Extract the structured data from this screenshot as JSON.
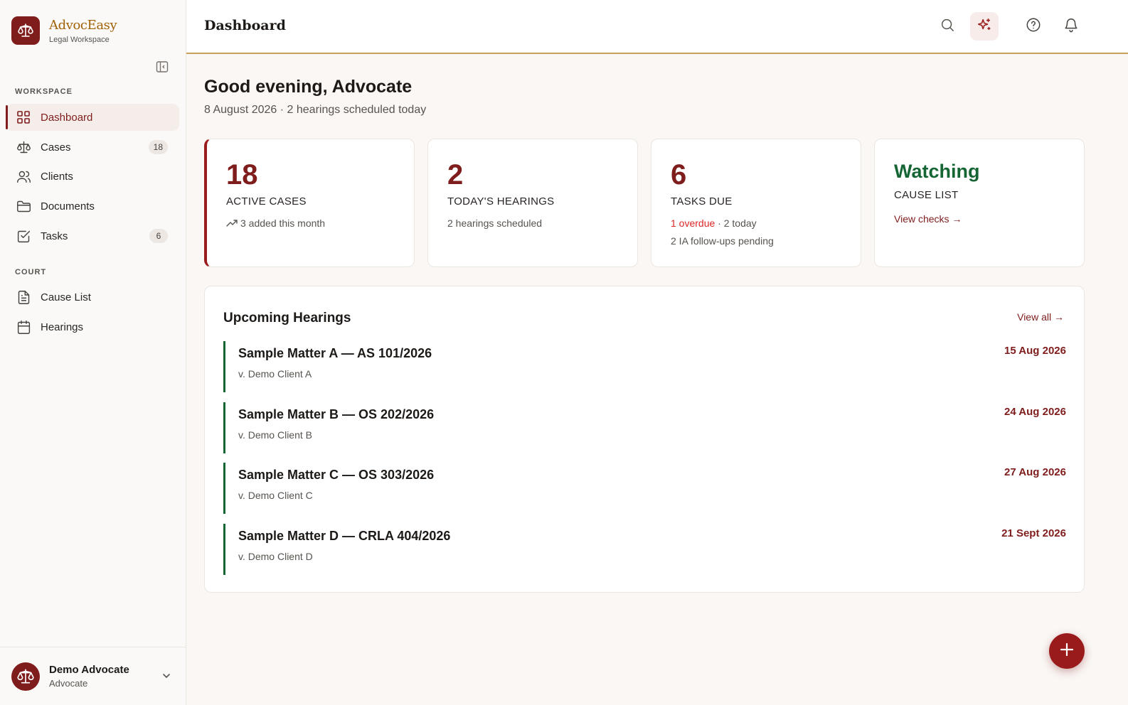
{
  "brand": {
    "name": "AdvocEasy",
    "subtitle": "Legal Workspace",
    "logo_icon": "scales-icon",
    "accent": "#7f1d1d"
  },
  "sidebar": {
    "sections": [
      {
        "label": "WORKSPACE",
        "items": [
          {
            "label": "Dashboard",
            "icon": "grid-icon",
            "active": true
          },
          {
            "label": "Cases",
            "icon": "scales-icon",
            "badge": "18"
          },
          {
            "label": "Clients",
            "icon": "users-icon"
          },
          {
            "label": "Documents",
            "icon": "folder-icon"
          },
          {
            "label": "Tasks",
            "icon": "checkbox-icon",
            "badge": "6"
          }
        ]
      },
      {
        "label": "COURT",
        "items": [
          {
            "label": "Cause List",
            "icon": "document-icon"
          },
          {
            "label": "Hearings",
            "icon": "calendar-icon"
          }
        ]
      }
    ],
    "user": {
      "name": "Demo Advocate",
      "role": "Advocate"
    }
  },
  "header": {
    "title": "Dashboard"
  },
  "greeting": {
    "title": "Good evening, Advocate",
    "subtitle": "8 August 2026 · 2 hearings scheduled today"
  },
  "cards": {
    "active_cases": {
      "value": "18",
      "label": "ACTIVE CASES",
      "sub": "3 added this month"
    },
    "hearings": {
      "value": "2",
      "label": "TODAY'S HEARINGS",
      "sub": "2 hearings scheduled"
    },
    "tasks": {
      "value": "6",
      "label": "TASKS DUE",
      "overdue": "1 overdue",
      "today": " · 2 today",
      "sub2": "2 IA follow-ups pending"
    },
    "cause_list": {
      "status": "Watching",
      "label": "CAUSE LIST",
      "link": "View checks →"
    }
  },
  "upcoming": {
    "title": "Upcoming Hearings",
    "view_all": "View all →",
    "items": [
      {
        "title": "Sample Matter A — AS 101/2026",
        "client": "v. Demo Client A",
        "date": "15 Aug 2026"
      },
      {
        "title": "Sample Matter B — OS 202/2026",
        "client": "v. Demo Client B",
        "date": "24 Aug 2026"
      },
      {
        "title": "Sample Matter C — OS 303/2026",
        "client": "v. Demo Client C",
        "date": "27 Aug 2026"
      },
      {
        "title": "Sample Matter D — CRLA 404/2026",
        "client": "v. Demo Client D",
        "date": "21 Sept 2026"
      }
    ]
  },
  "colors": {
    "primary": "#7f1d1d",
    "success": "#166534",
    "danger": "#dc2626",
    "gold": "#c8a25c"
  }
}
